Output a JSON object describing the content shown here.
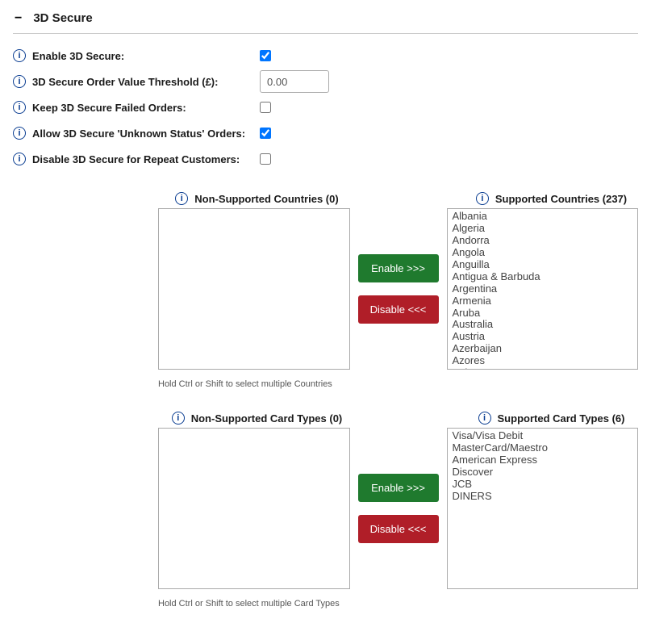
{
  "header": {
    "title": "3D Secure"
  },
  "form": {
    "enable_label": "Enable 3D Secure:",
    "enable_checked": true,
    "threshold_label": "3D Secure Order Value Threshold (£):",
    "threshold_value": "0.00",
    "keep_failed_label": "Keep 3D Secure Failed Orders:",
    "keep_failed_checked": false,
    "unknown_label": "Allow 3D Secure 'Unknown Status' Orders:",
    "unknown_checked": true,
    "disable_repeat_label": "Disable 3D Secure for Repeat Customers:",
    "disable_repeat_checked": false
  },
  "countries": {
    "non_supported_header": "Non-Supported Countries (0)",
    "supported_header": "Supported Countries (237)",
    "enable_btn": "Enable >>>",
    "disable_btn": "Disable <<<",
    "hint": "Hold Ctrl or Shift to select multiple Countries",
    "non_supported": [],
    "supported": [
      "Albania",
      "Algeria",
      "Andorra",
      "Angola",
      "Anguilla",
      "Antigua & Barbuda",
      "Argentina",
      "Armenia",
      "Aruba",
      "Australia",
      "Austria",
      "Azerbaijan",
      "Azores",
      "Bahamas"
    ]
  },
  "card_types": {
    "non_supported_header": "Non-Supported Card Types (0)",
    "supported_header": "Supported Card Types (6)",
    "enable_btn": "Enable >>>",
    "disable_btn": "Disable <<<",
    "hint": "Hold Ctrl or Shift to select multiple Card Types",
    "non_supported": [],
    "supported": [
      "Visa/Visa Debit",
      "MasterCard/Maestro",
      "American Express",
      "Discover",
      "JCB",
      "DINERS"
    ]
  }
}
